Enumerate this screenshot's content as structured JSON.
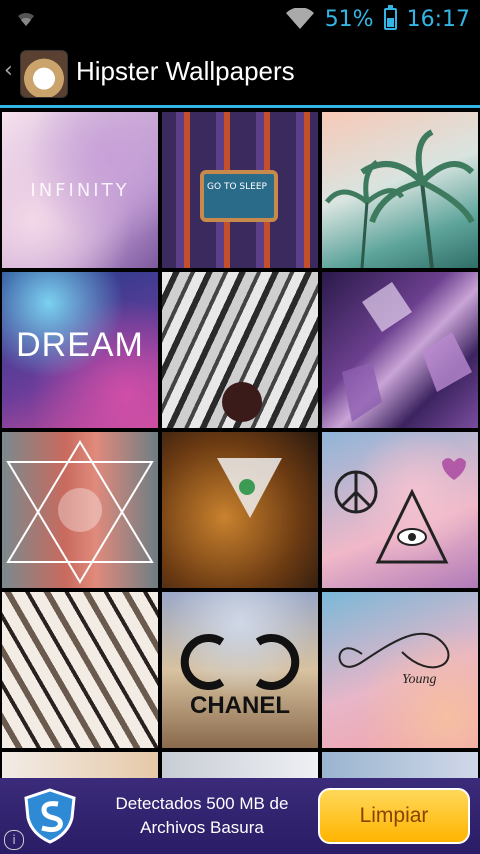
{
  "status": {
    "battery_percent": "51%",
    "battery_level": 0.51,
    "time": "16:17"
  },
  "actionbar": {
    "title": "Hipster Wallpapers",
    "up_icon": "chevron-left-icon",
    "app_icon": "grumpy-cat-app-icon"
  },
  "wallpapers": [
    {
      "name": "infinity-nebula",
      "text": "INFINITY"
    },
    {
      "name": "tools-flatlay",
      "text": "GO TO SLEEP"
    },
    {
      "name": "palm-trees",
      "text": ""
    },
    {
      "name": "dream-galaxy",
      "text": "DREAM"
    },
    {
      "name": "tiger-roar",
      "text": ""
    },
    {
      "name": "purple-crystals",
      "text": ""
    },
    {
      "name": "triangle-mirror",
      "text": ""
    },
    {
      "name": "tiger-triangle",
      "text": ""
    },
    {
      "name": "peace-eye-triangle",
      "text": ""
    },
    {
      "name": "tribal-pattern",
      "text": ""
    },
    {
      "name": "chanel-baroque",
      "text": "CHANEL"
    },
    {
      "name": "infinity-young",
      "text": "Young"
    }
  ],
  "ad": {
    "line1": "Detectados 500 MB de",
    "line2": "Archivos Basura",
    "button": "Limpiar",
    "info_icon": "i"
  },
  "colors": {
    "accent": "#33b5e5",
    "ad_bg": "#3b2b7a",
    "ad_button": "#ffc21a"
  }
}
